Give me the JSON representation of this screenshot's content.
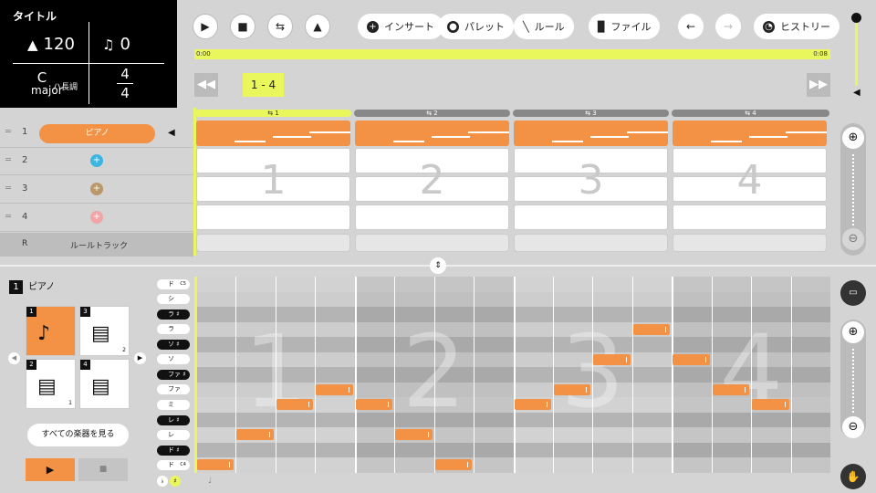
{
  "song": {
    "title": "タイトル",
    "tempo": "120",
    "beat_shift": "0",
    "key_letter": "C",
    "key_mode": "major",
    "key_jp": "ハ長調",
    "ts_top": "4",
    "ts_bottom": "4"
  },
  "toolbar": {
    "insert": "インサート",
    "palette": "パレット",
    "rule": "ルール",
    "file": "ファイル",
    "history": "ヒストリー"
  },
  "timeline": {
    "start": "0:00",
    "end": "0:08",
    "range": "1 - 4"
  },
  "tracks": [
    {
      "num": "1",
      "instrument": "ピアノ"
    },
    {
      "num": "2",
      "badge": "+",
      "color": "#3bb6e0"
    },
    {
      "num": "3",
      "badge": "+",
      "color": "#b9986a"
    },
    {
      "num": "4",
      "badge": "+",
      "color": "#f0a6a6"
    }
  ],
  "rule_track": {
    "code": "R",
    "label": "ルールトラック"
  },
  "bars": [
    "1",
    "2",
    "3",
    "4"
  ],
  "bar_headers": [
    "⇆ 1",
    "⇆ 2",
    "⇆ 3",
    "⇆ 4"
  ],
  "current_instrument": {
    "num": "1",
    "name": "ピアノ"
  },
  "instrument_slots": [
    {
      "num": "1",
      "sub": "",
      "selected": true
    },
    {
      "num": "3",
      "sub": "2",
      "selected": false
    },
    {
      "num": "2",
      "sub": "1",
      "selected": false
    },
    {
      "num": "4",
      "sub": "",
      "selected": false
    }
  ],
  "all_instruments": "すべての楽器を見る",
  "keys": [
    {
      "label": "ド",
      "oct": "C5",
      "black": false
    },
    {
      "label": "シ",
      "oct": "",
      "black": false
    },
    {
      "label": "ラ ♯",
      "oct": "",
      "black": true
    },
    {
      "label": "ラ",
      "oct": "",
      "black": false
    },
    {
      "label": "ソ ♯",
      "oct": "",
      "black": true
    },
    {
      "label": "ソ",
      "oct": "",
      "black": false
    },
    {
      "label": "ファ ♯",
      "oct": "",
      "black": true
    },
    {
      "label": "ファ",
      "oct": "",
      "black": false
    },
    {
      "label": "ミ",
      "oct": "",
      "black": false
    },
    {
      "label": "レ ♯",
      "oct": "",
      "black": true
    },
    {
      "label": "レ",
      "oct": "",
      "black": false
    },
    {
      "label": "ド ♯",
      "oct": "",
      "black": true
    },
    {
      "label": "ド",
      "oct": "C4",
      "black": false
    }
  ],
  "notes": [
    {
      "bar": 1,
      "step": 0,
      "key": 12
    },
    {
      "bar": 1,
      "step": 1,
      "key": 10
    },
    {
      "bar": 1,
      "step": 2,
      "key": 8
    },
    {
      "bar": 1,
      "step": 3,
      "key": 7
    },
    {
      "bar": 2,
      "step": 0,
      "key": 8
    },
    {
      "bar": 2,
      "step": 1,
      "key": 10
    },
    {
      "bar": 2,
      "step": 2,
      "key": 12
    },
    {
      "bar": 3,
      "step": 0,
      "key": 8
    },
    {
      "bar": 3,
      "step": 1,
      "key": 7
    },
    {
      "bar": 3,
      "step": 2,
      "key": 5
    },
    {
      "bar": 3,
      "step": 3,
      "key": 3
    },
    {
      "bar": 4,
      "step": 0,
      "key": 5
    },
    {
      "bar": 4,
      "step": 1,
      "key": 7
    },
    {
      "bar": 4,
      "step": 2,
      "key": 8
    }
  ],
  "accidentals": {
    "flat": "♭",
    "sharp": "♯"
  },
  "colors": {
    "accent": "#f39244",
    "highlight": "#eaf75c"
  }
}
